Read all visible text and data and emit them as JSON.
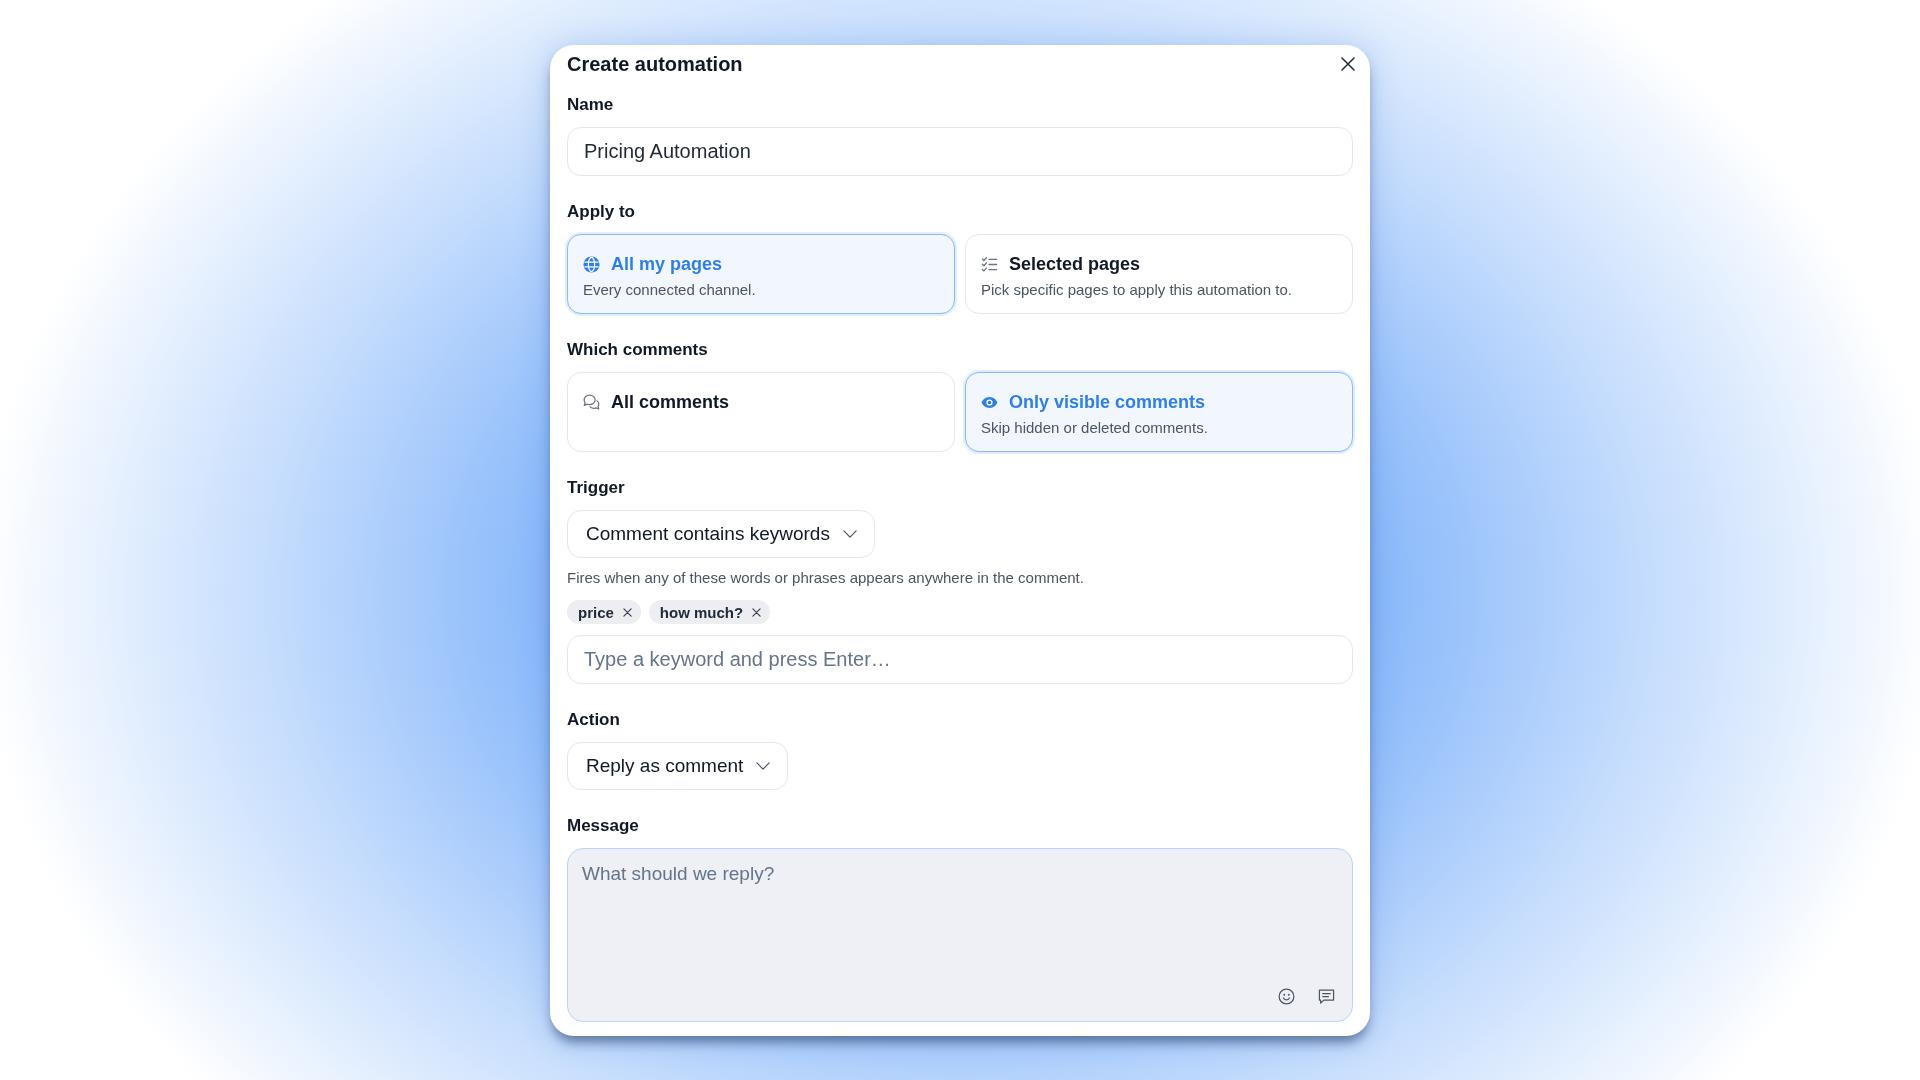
{
  "dialog": {
    "title": "Create automation"
  },
  "name": {
    "label": "Name",
    "value": "Pricing Automation"
  },
  "apply_to": {
    "label": "Apply to",
    "options": [
      {
        "title": "All my pages",
        "description": "Every connected channel.",
        "selected": true
      },
      {
        "title": "Selected pages",
        "description": "Pick specific pages to apply this automation to.",
        "selected": false
      }
    ]
  },
  "which_comments": {
    "label": "Which comments",
    "options": [
      {
        "title": "All comments",
        "selected": false
      },
      {
        "title": "Only visible comments",
        "description": "Skip hidden or deleted comments.",
        "selected": true
      }
    ]
  },
  "trigger": {
    "label": "Trigger",
    "value": "Comment contains keywords",
    "help": "Fires when any of these words or phrases appears anywhere in the comment.",
    "keywords": [
      "price",
      "how much?"
    ],
    "keyword_input": {
      "placeholder": "Type a keyword and press Enter…"
    }
  },
  "action": {
    "label": "Action",
    "value": "Reply as comment"
  },
  "message": {
    "label": "Message",
    "placeholder": "What should we reply?"
  }
}
